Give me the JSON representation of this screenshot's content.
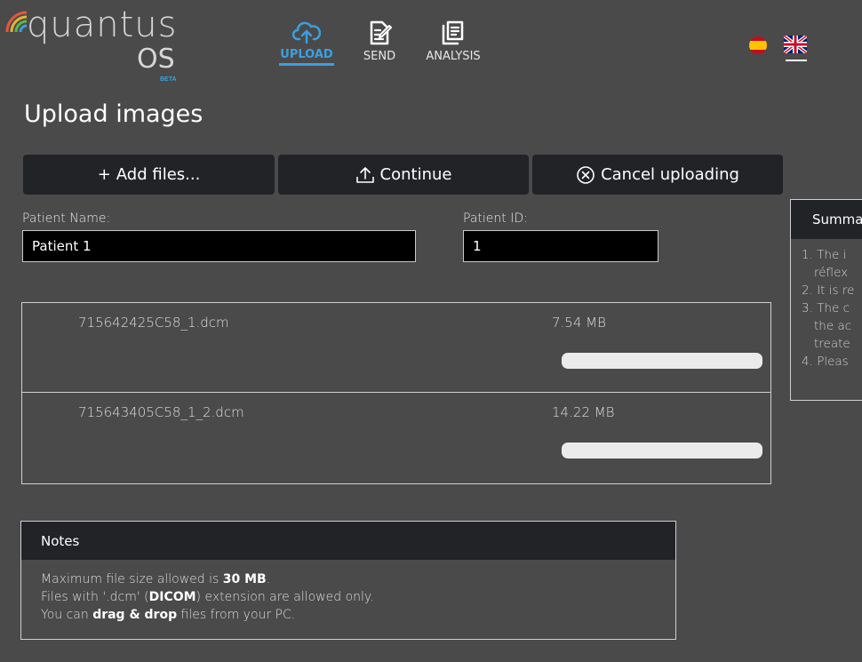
{
  "app": {
    "logo_word": "quantus",
    "logo_os": "OS",
    "logo_badge": "BETA",
    "accent_color": "#3aa0e0",
    "logo_colors": [
      "#e05a3a",
      "#e0b43a",
      "#5ab84a",
      "#3aa0e0"
    ]
  },
  "nav": {
    "items": [
      {
        "label": "UPLOAD",
        "icon": "cloud-upload-icon",
        "active": true
      },
      {
        "label": "SEND",
        "icon": "send-document-icon",
        "active": false
      },
      {
        "label": "ANALYSIS",
        "icon": "analysis-document-icon",
        "active": false
      }
    ]
  },
  "languages": [
    {
      "icon": "spain-flag-icon",
      "active": false
    },
    {
      "icon": "uk-flag-icon",
      "active": true
    }
  ],
  "page": {
    "title": "Upload images"
  },
  "toolbar": {
    "add_label": "Add files...",
    "add_icon": "plus-icon",
    "continue_label": "Continue",
    "continue_icon": "upload-arrow-icon",
    "cancel_label": "Cancel uploading",
    "cancel_icon": "circle-x-icon"
  },
  "form": {
    "patient_name_label": "Patient Name:",
    "patient_name_value": "Patient 1",
    "patient_id_label": "Patient ID:",
    "patient_id_value": "1"
  },
  "files": [
    {
      "name": "715642425C58_1.dcm",
      "size": "7.54 MB",
      "progress": 0
    },
    {
      "name": "715643405C58_1_2.dcm",
      "size": "14.22 MB",
      "progress": 0
    }
  ],
  "summary": {
    "title": "Summa",
    "items": [
      {
        "num": "1.",
        "line1": "The i",
        "line2": "réflex"
      },
      {
        "num": "2.",
        "line1": "It is re",
        "line2": ""
      },
      {
        "num": "3.",
        "line1": "The c",
        "line2": "the ac",
        "line3": "treate"
      },
      {
        "num": "4.",
        "line1": "Pleas",
        "line2": ""
      }
    ]
  },
  "notes": {
    "title": "Notes",
    "line1_pre": "Maximum file size allowed is ",
    "line1_bold": "30 MB",
    "line1_post": ".",
    "line2_pre": "Files with '.dcm' (",
    "line2_bold": "DICOM",
    "line2_post": ") extension are allowed only.",
    "line3_pre": "You can ",
    "line3_bold": "drag & drop",
    "line3_post": " files from your PC."
  }
}
